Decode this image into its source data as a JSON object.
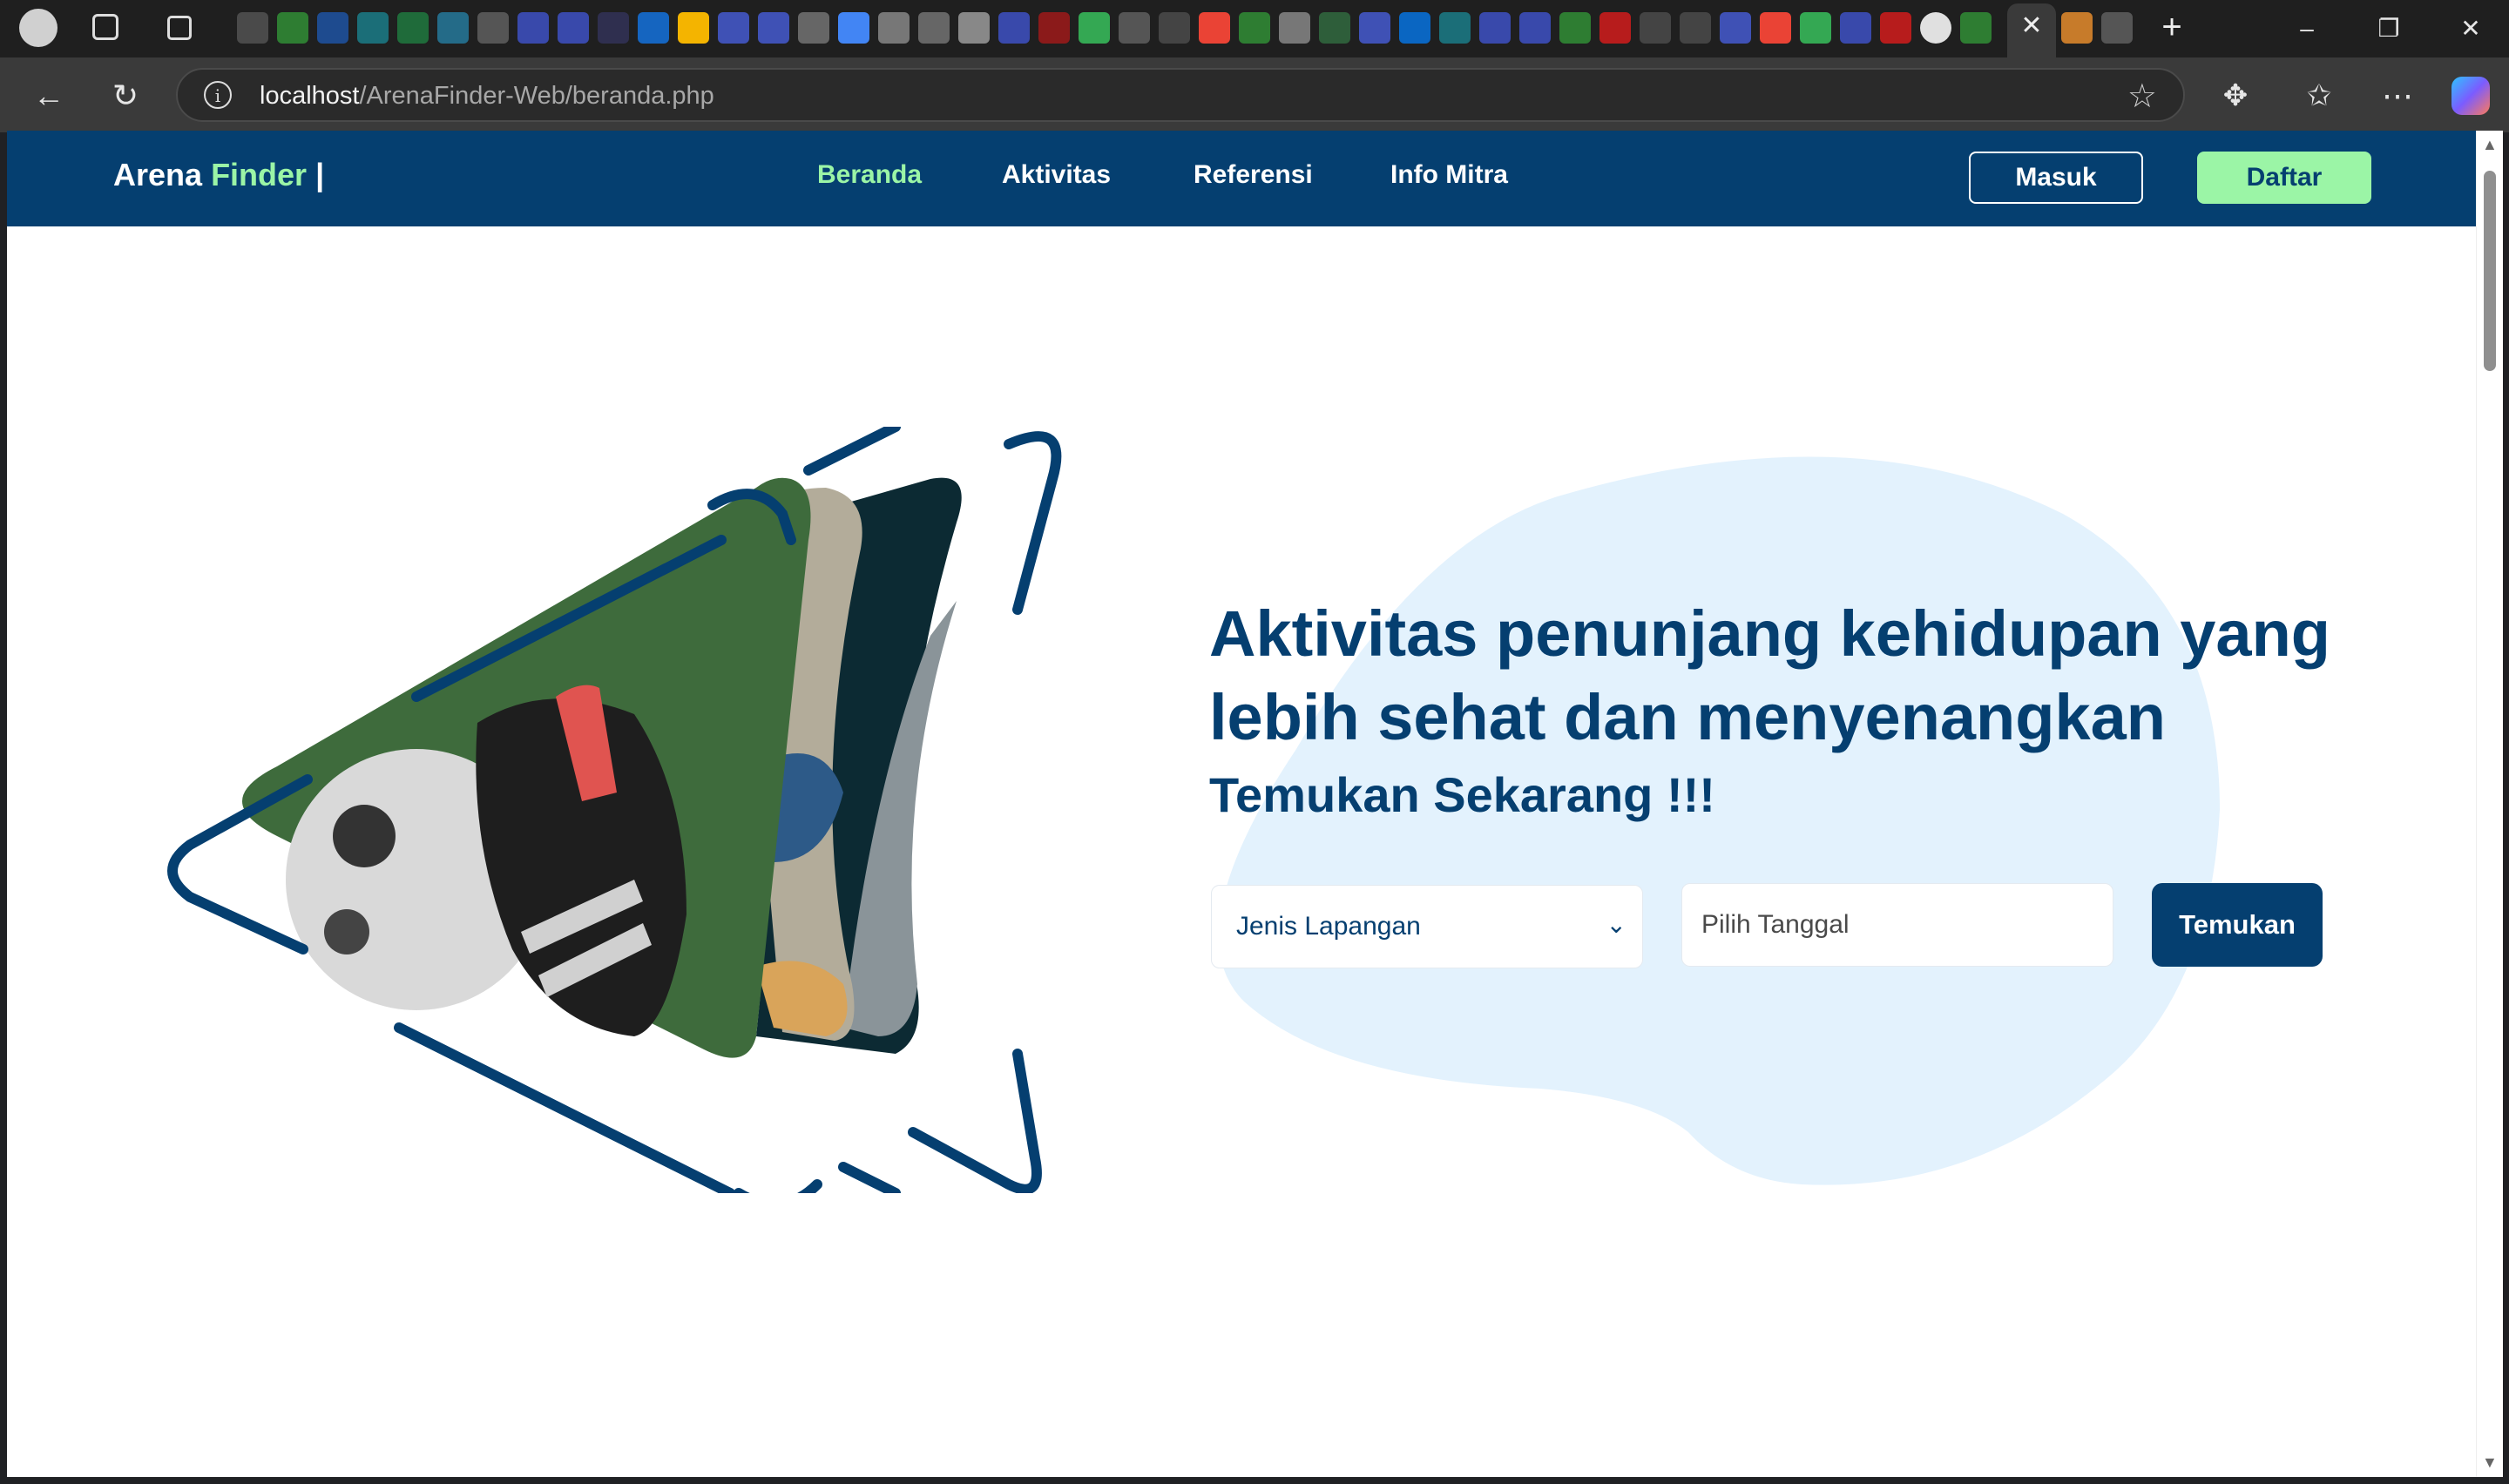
{
  "browser": {
    "address_url_host": "localhost",
    "address_url_path": "/ArenaFinder-Web/beranda.php"
  },
  "site": {
    "brand_primary": "Arena",
    "brand_accent": "Finder",
    "brand_cursor": "|",
    "nav": [
      {
        "label": "Beranda",
        "active": true
      },
      {
        "label": "Aktivitas",
        "active": false
      },
      {
        "label": "Referensi",
        "active": false
      },
      {
        "label": "Info Mitra",
        "active": false
      }
    ],
    "login_label": "Masuk",
    "register_label": "Daftar"
  },
  "hero": {
    "headline": "Aktivitas penunjang kehidupan yang lebih sehat dan menyenangkan",
    "subheadline": "Temukan Sekarang !!!",
    "field_type_label": "Jenis Lapangan",
    "date_placeholder": "Pilih Tanggal",
    "search_button": "Temukan"
  },
  "colors": {
    "navy": "#053f70",
    "accent_green": "#9bf5a6",
    "blob": "#e3f2fd"
  },
  "icons": {
    "tab_close": "close-icon",
    "new_tab": "plus-icon",
    "back": "back-arrow-icon",
    "reload": "reload-icon",
    "info": "info-icon",
    "favorite": "star-icon",
    "extensions": "puzzle-icon",
    "favorites": "favorites-icon",
    "menu": "more-icon",
    "select": "chevron-down-icon"
  }
}
